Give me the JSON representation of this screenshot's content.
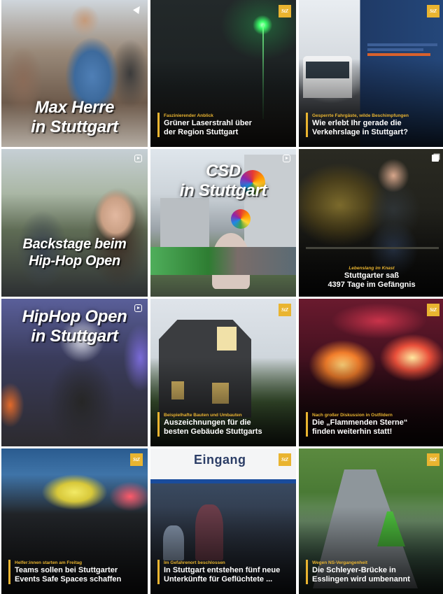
{
  "tiles": [
    {
      "type": "reel",
      "title": "Max Herre\nin Stuttgart"
    },
    {
      "type": "post",
      "kicker": "Faszinierender Anblick",
      "headline": "Grüner Laserstrahl über\nder Region Stuttgart"
    },
    {
      "type": "post",
      "kicker": "Gesperrte Fahrgäste, wilde Beschimpfungen",
      "headline": "Wie erlebt Ihr gerade die\nVerkehrslage in Stuttgart?"
    },
    {
      "type": "reel",
      "title": "Backstage beim\nHip-Hop Open"
    },
    {
      "type": "reel",
      "title": "CSD\nin Stuttgart"
    },
    {
      "type": "post",
      "kicker": "Lebenslang im Knast",
      "headline": "Stuttgarter saß\n4397 Tage im Gefängnis"
    },
    {
      "type": "reel",
      "title": "HipHop Open\nin Stuttgart"
    },
    {
      "type": "post",
      "kicker": "Beispielhafte Bauten und Umbauten",
      "headline": "Auszeichnungen für die\nbesten Gebäude Stuttgarts"
    },
    {
      "type": "post",
      "kicker": "Nach großer Diskussion in Ostfildern",
      "headline": "Die „Flammenden Sterne“\nfinden weiterhin statt!"
    },
    {
      "type": "post",
      "kicker": "Helfer:innen starten am Freitag",
      "headline": "Teams sollen bei Stuttgarter\nEvents Safe Spaces schaffen"
    },
    {
      "type": "post",
      "kicker": "Im Gefahrenort beschlossen",
      "headline": "In Stuttgart entstehen fünf neue\nUnterkünfte für Geflüchtete ...",
      "sign": "Eingang"
    },
    {
      "type": "post",
      "kicker": "Wegen NS-Vergangenheit",
      "headline": "Die Schleyer-Brücke in\nEsslingen wird umbenannt"
    }
  ],
  "brand": {
    "logo": "StZ",
    "accent": "#e9b430"
  },
  "icons": {
    "reel": "reel-icon",
    "pinned": "pin-icon",
    "carousel": "carousel-icon",
    "logo": "stz-logo"
  }
}
